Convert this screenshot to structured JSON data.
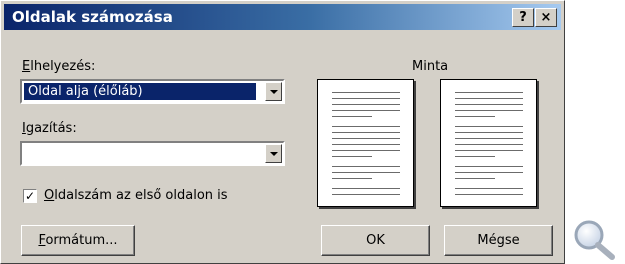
{
  "dialog": {
    "title": "Oldalak számozása",
    "help_button": "?",
    "close_button": "×"
  },
  "position": {
    "label_accel": "E",
    "label_rest": "lhelyezés:",
    "value": "Oldal alja (élőláb)"
  },
  "alignment": {
    "label_accel": "I",
    "label_rest": "gazítás:",
    "value": ""
  },
  "first_page": {
    "checked": true,
    "check_glyph": "✓",
    "label_accel": "O",
    "label_rest": "ldalszám az első oldalon is"
  },
  "preview": {
    "label": "Minta"
  },
  "buttons": {
    "format_accel": "F",
    "format_rest": "ormátum...",
    "ok": "OK",
    "cancel": "Mégse"
  },
  "icons": {
    "magnifier": "magnifier-icon"
  }
}
